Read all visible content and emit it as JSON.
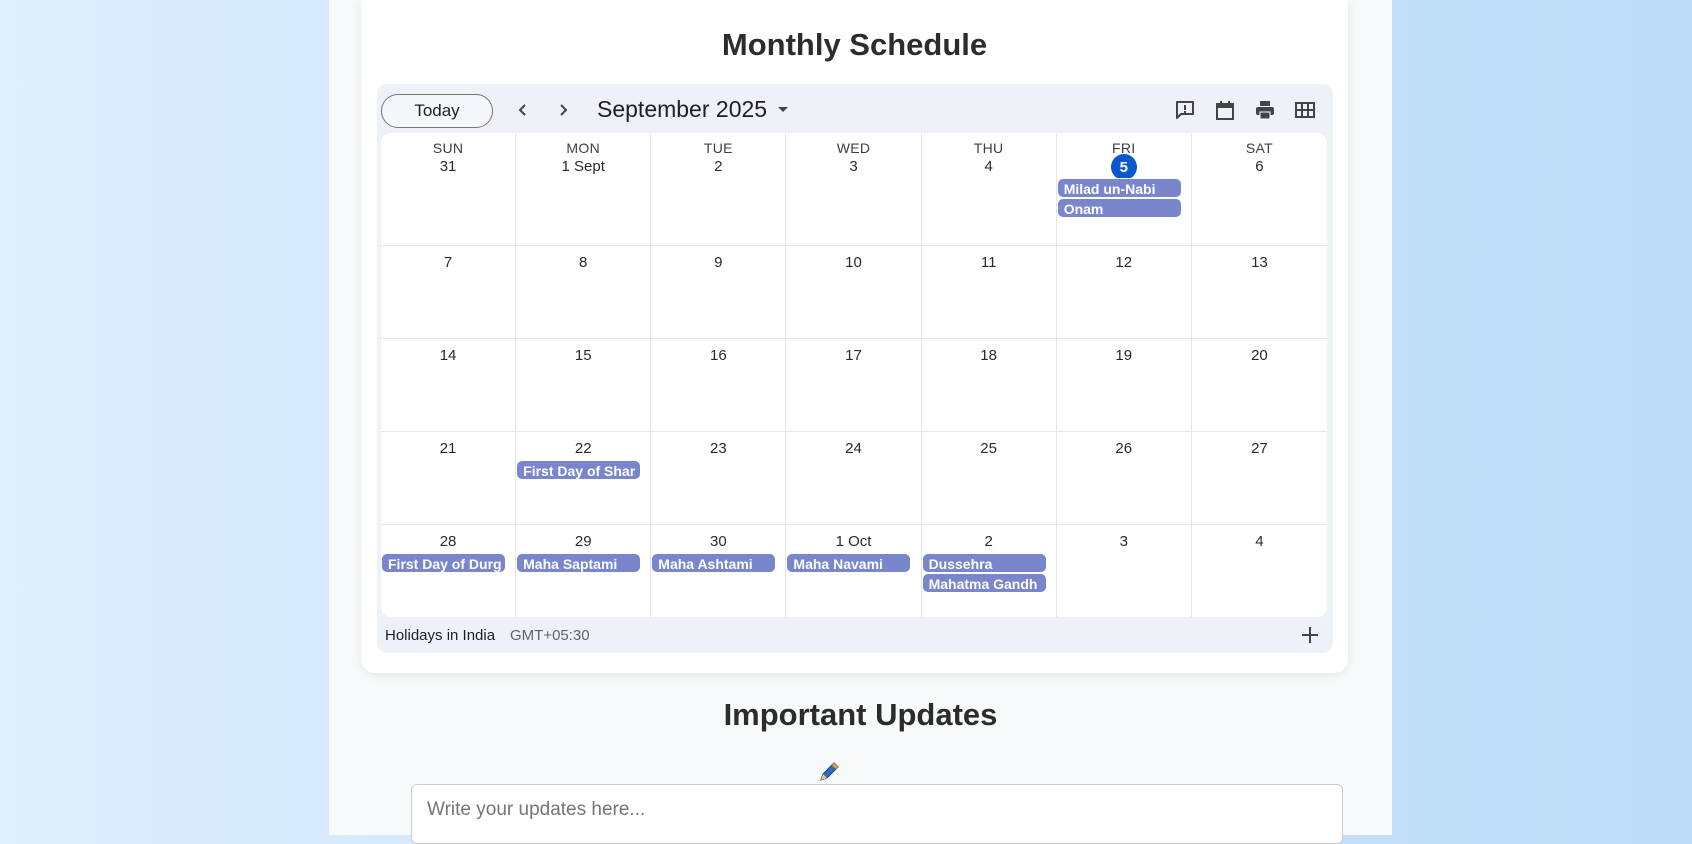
{
  "headings": {
    "schedule": "Monthly Schedule",
    "updates": "Important Updates"
  },
  "calendar": {
    "today_label": "Today",
    "month_label": "September 2025",
    "footer": {
      "calendar_name": "Holidays in India",
      "timezone": "GMT+05:30"
    },
    "weekdays": [
      "SUN",
      "MON",
      "TUE",
      "WED",
      "THU",
      "FRI",
      "SAT"
    ],
    "weeks": [
      [
        {
          "day": "31",
          "events": []
        },
        {
          "day": "1 Sept",
          "events": []
        },
        {
          "day": "2",
          "events": []
        },
        {
          "day": "3",
          "events": []
        },
        {
          "day": "4",
          "events": []
        },
        {
          "day": "5",
          "today": true,
          "events": [
            "Milad un-Nabi",
            "Onam"
          ]
        },
        {
          "day": "6",
          "events": []
        }
      ],
      [
        {
          "day": "7",
          "events": []
        },
        {
          "day": "8",
          "events": []
        },
        {
          "day": "9",
          "events": []
        },
        {
          "day": "10",
          "events": []
        },
        {
          "day": "11",
          "events": []
        },
        {
          "day": "12",
          "events": []
        },
        {
          "day": "13",
          "events": []
        }
      ],
      [
        {
          "day": "14",
          "events": []
        },
        {
          "day": "15",
          "events": []
        },
        {
          "day": "16",
          "events": []
        },
        {
          "day": "17",
          "events": []
        },
        {
          "day": "18",
          "events": []
        },
        {
          "day": "19",
          "events": []
        },
        {
          "day": "20",
          "events": []
        }
      ],
      [
        {
          "day": "21",
          "events": []
        },
        {
          "day": "22",
          "events": [
            "First Day of Shar"
          ]
        },
        {
          "day": "23",
          "events": []
        },
        {
          "day": "24",
          "events": []
        },
        {
          "day": "25",
          "events": []
        },
        {
          "day": "26",
          "events": []
        },
        {
          "day": "27",
          "events": []
        }
      ],
      [
        {
          "day": "28",
          "events": [
            "First Day of Durg"
          ]
        },
        {
          "day": "29",
          "events": [
            "Maha Saptami"
          ]
        },
        {
          "day": "30",
          "events": [
            "Maha Ashtami"
          ]
        },
        {
          "day": "1 Oct",
          "events": [
            "Maha Navami"
          ]
        },
        {
          "day": "2",
          "events": [
            "Dussehra",
            "Mahatma Gandh"
          ]
        },
        {
          "day": "3",
          "events": []
        },
        {
          "day": "4",
          "events": []
        }
      ]
    ]
  },
  "updates": {
    "placeholder": "Write your updates here..."
  },
  "colors": {
    "event": "#7986cb",
    "today": "#0b57d0",
    "accent_text": "#2c2c2c"
  },
  "icons": [
    "chevron-left-icon",
    "chevron-right-icon",
    "dropdown-arrow-icon",
    "feedback-icon",
    "calendar-icon",
    "print-icon",
    "grid-view-icon",
    "plus-icon",
    "pen-icon"
  ]
}
